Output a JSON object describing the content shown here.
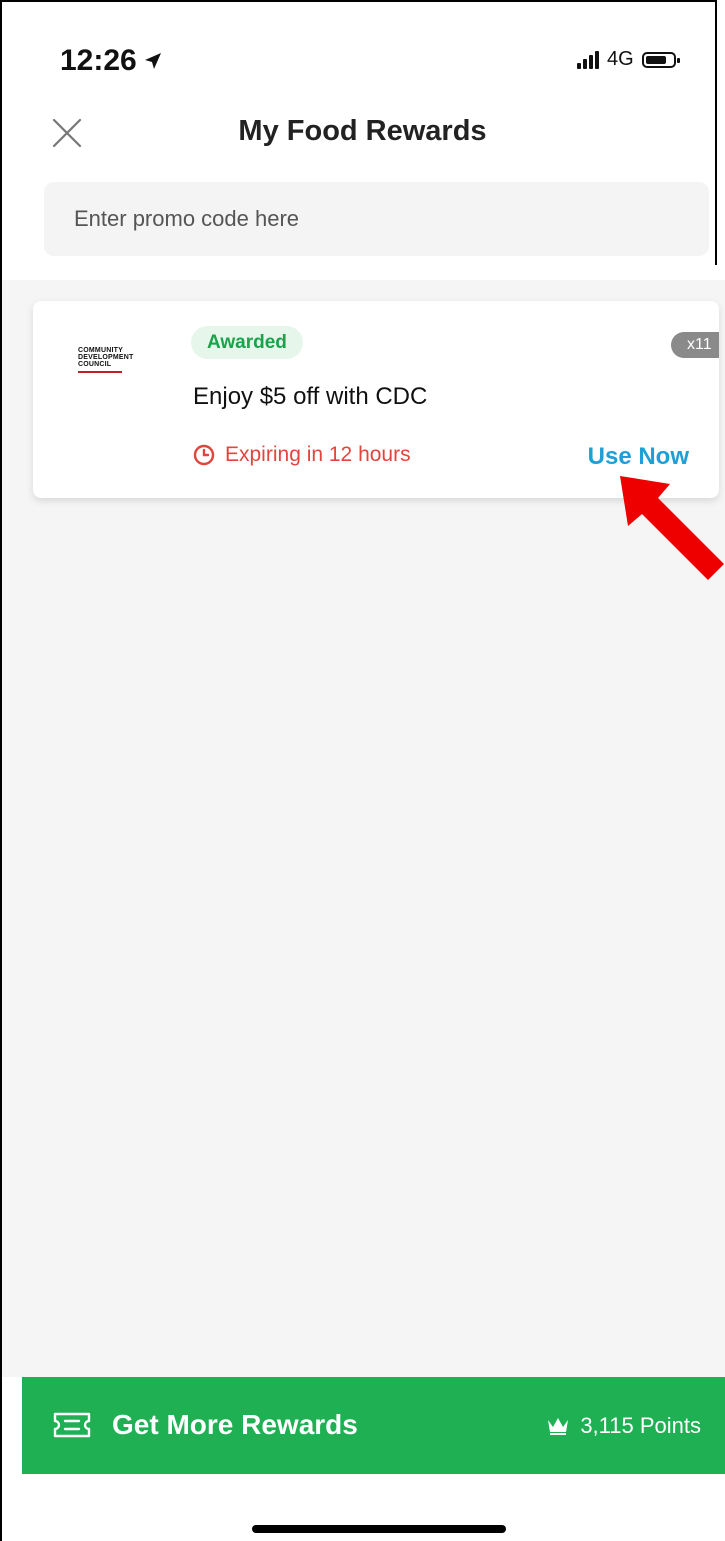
{
  "status_bar": {
    "time": "12:26",
    "network": "4G",
    "location_icon": "location-arrow-icon",
    "signal_icon": "signal-icon",
    "battery_icon": "battery-icon"
  },
  "header": {
    "title": "My Food Rewards",
    "close_icon": "close-icon"
  },
  "promo": {
    "placeholder": "Enter promo code here"
  },
  "rewards": [
    {
      "logo": {
        "line1": "COMMUNITY",
        "line2": "DEVELOPMENT",
        "line3": "COUNCIL"
      },
      "status": "Awarded",
      "count": "x11",
      "title": "Enjoy $5 off with CDC",
      "expiry": "Expiring in 12 hours",
      "action": "Use Now"
    }
  ],
  "bottom_bar": {
    "label": "Get More Rewards",
    "points": "3,115 Points",
    "icon": "ticket-icon",
    "points_icon": "crown-icon"
  },
  "colors": {
    "brand_green": "#1fb053",
    "link_blue": "#1e9fd8",
    "expiry_red": "#e2453c",
    "awarded_green": "#1aa34a",
    "annotation_arrow": "#ee0000"
  }
}
